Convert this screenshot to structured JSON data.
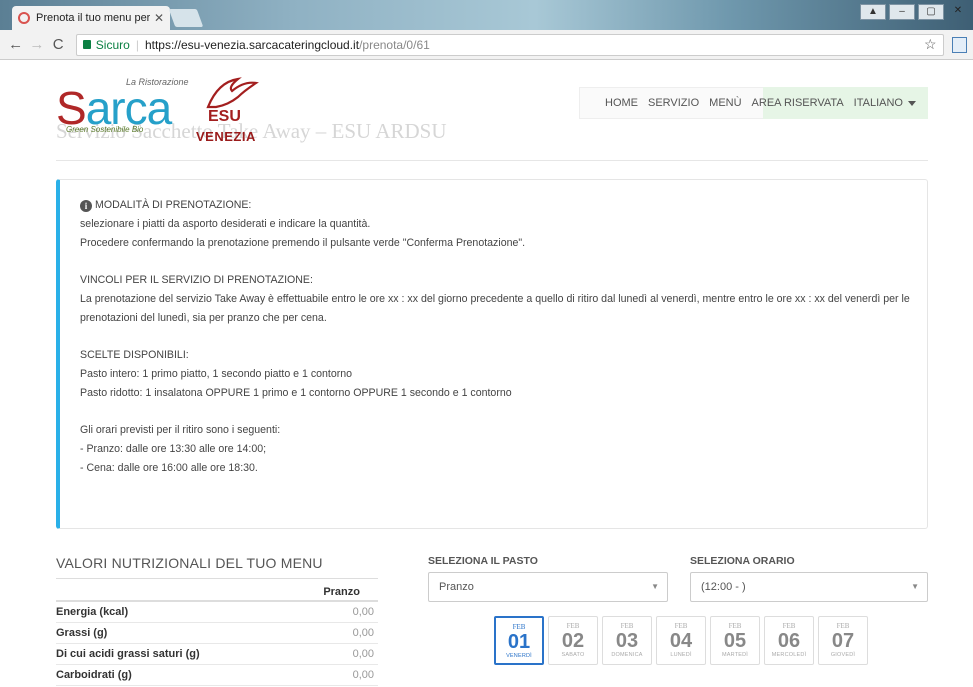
{
  "browser": {
    "tab_title": "Prenota il tuo menu pers",
    "tab_close": "✕",
    "secure_label": "Sicuro",
    "url_host": "https://esu-venezia.sarcacateringcloud.it",
    "url_path": "/prenota/0/61"
  },
  "logo": {
    "s": "S",
    "arca": "arca",
    "sub1": "La Ristorazione",
    "sub2": "Green Sostenibile Bio",
    "venezia": "VENEZIA",
    "esu": "ESU"
  },
  "ghost_title": "Servizio Sacchetto Take Away – ESU ARDSU",
  "nav": {
    "home": "HOME",
    "servizio": "SERVIZIO",
    "menu": "MENÙ",
    "area": "AREA RISERVATA",
    "lang": "ITALIANO"
  },
  "info": {
    "l1": "MODALITÀ DI PRENOTAZIONE:",
    "l2": "selezionare i piatti da asporto desiderati e indicare la quantità.",
    "l3": "Procedere confermando la prenotazione premendo il pulsante verde \"Conferma Prenotazione\".",
    "l4": "VINCOLI PER IL SERVIZIO DI PRENOTAZIONE:",
    "l5": "La prenotazione del servizio Take Away è effettuabile entro le ore xx : xx del giorno precedente a quello di ritiro dal lunedì al venerdì, mentre entro le ore xx : xx del venerdì per le prenotazioni del lunedì, sia per pranzo che per cena.",
    "l6": "SCELTE DISPONIBILI:",
    "l7": "Pasto intero: 1 primo piatto, 1 secondo piatto e 1 contorno",
    "l8": "Pasto ridotto: 1 insalatona OPPURE 1 primo e 1 contorno OPPURE 1 secondo e 1 contorno",
    "l9": "Gli orari previsti per il ritiro sono i seguenti:",
    "l10": "- Pranzo: dalle ore 13:30 alle ore 14:00;",
    "l11": "- Cena: dalle ore 16:00 alle ore 18:30."
  },
  "nutri": {
    "title": "VALORI NUTRIZIONALI DEL TUO MENU",
    "col": "Pranzo",
    "rows": [
      {
        "label": "Energia (kcal)",
        "value": "0,00"
      },
      {
        "label": "Grassi (g)",
        "value": "0,00"
      },
      {
        "label": "Di cui acidi grassi saturi (g)",
        "value": "0,00"
      },
      {
        "label": "Carboidrati (g)",
        "value": "0,00"
      }
    ]
  },
  "pasto": {
    "label": "SELEZIONA IL PASTO",
    "value": "Pranzo"
  },
  "orario": {
    "label": "SELEZIONA ORARIO",
    "value": "(12:00 - )"
  },
  "days": [
    {
      "m": "FEB",
      "d": "01",
      "w": "VENERDÌ"
    },
    {
      "m": "FEB",
      "d": "02",
      "w": "SABATO"
    },
    {
      "m": "FEB",
      "d": "03",
      "w": "DOMENICA"
    },
    {
      "m": "FEB",
      "d": "04",
      "w": "LUNEDÌ"
    },
    {
      "m": "FEB",
      "d": "05",
      "w": "MARTEDÌ"
    },
    {
      "m": "FEB",
      "d": "06",
      "w": "MERCOLEDÌ"
    },
    {
      "m": "FEB",
      "d": "07",
      "w": "GIOVEDÌ"
    }
  ],
  "colors": {
    "accent": "#2ab0e8",
    "active_day": "#2a73c9",
    "brand_red": "#b02828",
    "brand_blue": "#26a0c9"
  }
}
